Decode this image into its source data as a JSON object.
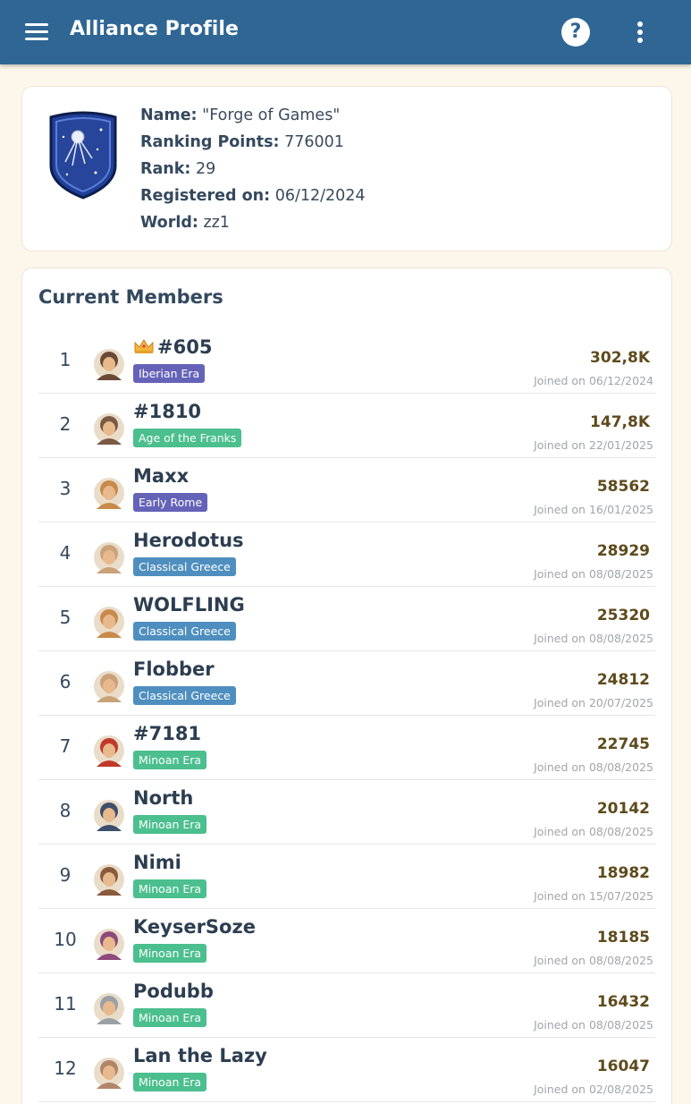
{
  "header": {
    "title": "Alliance Profile",
    "help_icon": "question-circle-icon",
    "more_icon": "kebab-menu-icon",
    "menu_icon": "hamburger-icon",
    "color": "#2f6694"
  },
  "profile": {
    "name_label": "Name:",
    "name_value": "\"Forge of Games\"",
    "points_label": "Ranking Points:",
    "points_value": "776001",
    "rank_label": "Rank:",
    "rank_value": "29",
    "registered_label": "Registered on:",
    "registered_value": "06/12/2024",
    "world_label": "World:",
    "world_value": "zz1",
    "emblem_icon": "satellite-shield-icon"
  },
  "members": {
    "title": "Current Members",
    "rows": [
      {
        "rank": "1",
        "name": "#605",
        "leader": true,
        "era": "Iberian Era",
        "era_color": "#6563b8",
        "points": "302,8K",
        "joined": "Joined on 06/12/2024",
        "avatar_color": "#6a4a36"
      },
      {
        "rank": "2",
        "name": "#1810",
        "leader": false,
        "era": "Age of the Franks",
        "era_color": "#4bbf8e",
        "points": "147,8K",
        "joined": "Joined on 22/01/2025",
        "avatar_color": "#7a5a44"
      },
      {
        "rank": "3",
        "name": "Maxx",
        "leader": false,
        "era": "Early Rome",
        "era_color": "#6563b8",
        "points": "58562",
        "joined": "Joined on 16/01/2025",
        "avatar_color": "#c88a4a"
      },
      {
        "rank": "4",
        "name": "Herodotus",
        "leader": false,
        "era": "Classical Greece",
        "era_color": "#4f8fbf",
        "points": "28929",
        "joined": "Joined on 08/08/2025",
        "avatar_color": "#c9a27a"
      },
      {
        "rank": "5",
        "name": "WOLFLING",
        "leader": false,
        "era": "Classical Greece",
        "era_color": "#4f8fbf",
        "points": "25320",
        "joined": "Joined on 08/08/2025",
        "avatar_color": "#c88a4a"
      },
      {
        "rank": "6",
        "name": "Flobber",
        "leader": false,
        "era": "Classical Greece",
        "era_color": "#4f8fbf",
        "points": "24812",
        "joined": "Joined on 20/07/2025",
        "avatar_color": "#c9a27a"
      },
      {
        "rank": "7",
        "name": "#7181",
        "leader": false,
        "era": "Minoan Era",
        "era_color": "#4bbf8e",
        "points": "22745",
        "joined": "Joined on 08/08/2025",
        "avatar_color": "#c0392b"
      },
      {
        "rank": "8",
        "name": "North",
        "leader": false,
        "era": "Minoan Era",
        "era_color": "#4bbf8e",
        "points": "20142",
        "joined": "Joined on 08/08/2025",
        "avatar_color": "#3d4f6a"
      },
      {
        "rank": "9",
        "name": "Nimi",
        "leader": false,
        "era": "Minoan Era",
        "era_color": "#4bbf8e",
        "points": "18982",
        "joined": "Joined on 15/07/2025",
        "avatar_color": "#8a5a3c"
      },
      {
        "rank": "10",
        "name": "KeyserSoze",
        "leader": false,
        "era": "Minoan Era",
        "era_color": "#4bbf8e",
        "points": "18185",
        "joined": "Joined on 08/08/2025",
        "avatar_color": "#8e4a7a"
      },
      {
        "rank": "11",
        "name": "Podubb",
        "leader": false,
        "era": "Minoan Era",
        "era_color": "#4bbf8e",
        "points": "16432",
        "joined": "Joined on 08/08/2025",
        "avatar_color": "#9aa0a6"
      },
      {
        "rank": "12",
        "name": "Lan the Lazy",
        "leader": false,
        "era": "Minoan Era",
        "era_color": "#4bbf8e",
        "points": "16047",
        "joined": "Joined on 02/08/2025",
        "avatar_color": "#b0866a"
      }
    ]
  }
}
